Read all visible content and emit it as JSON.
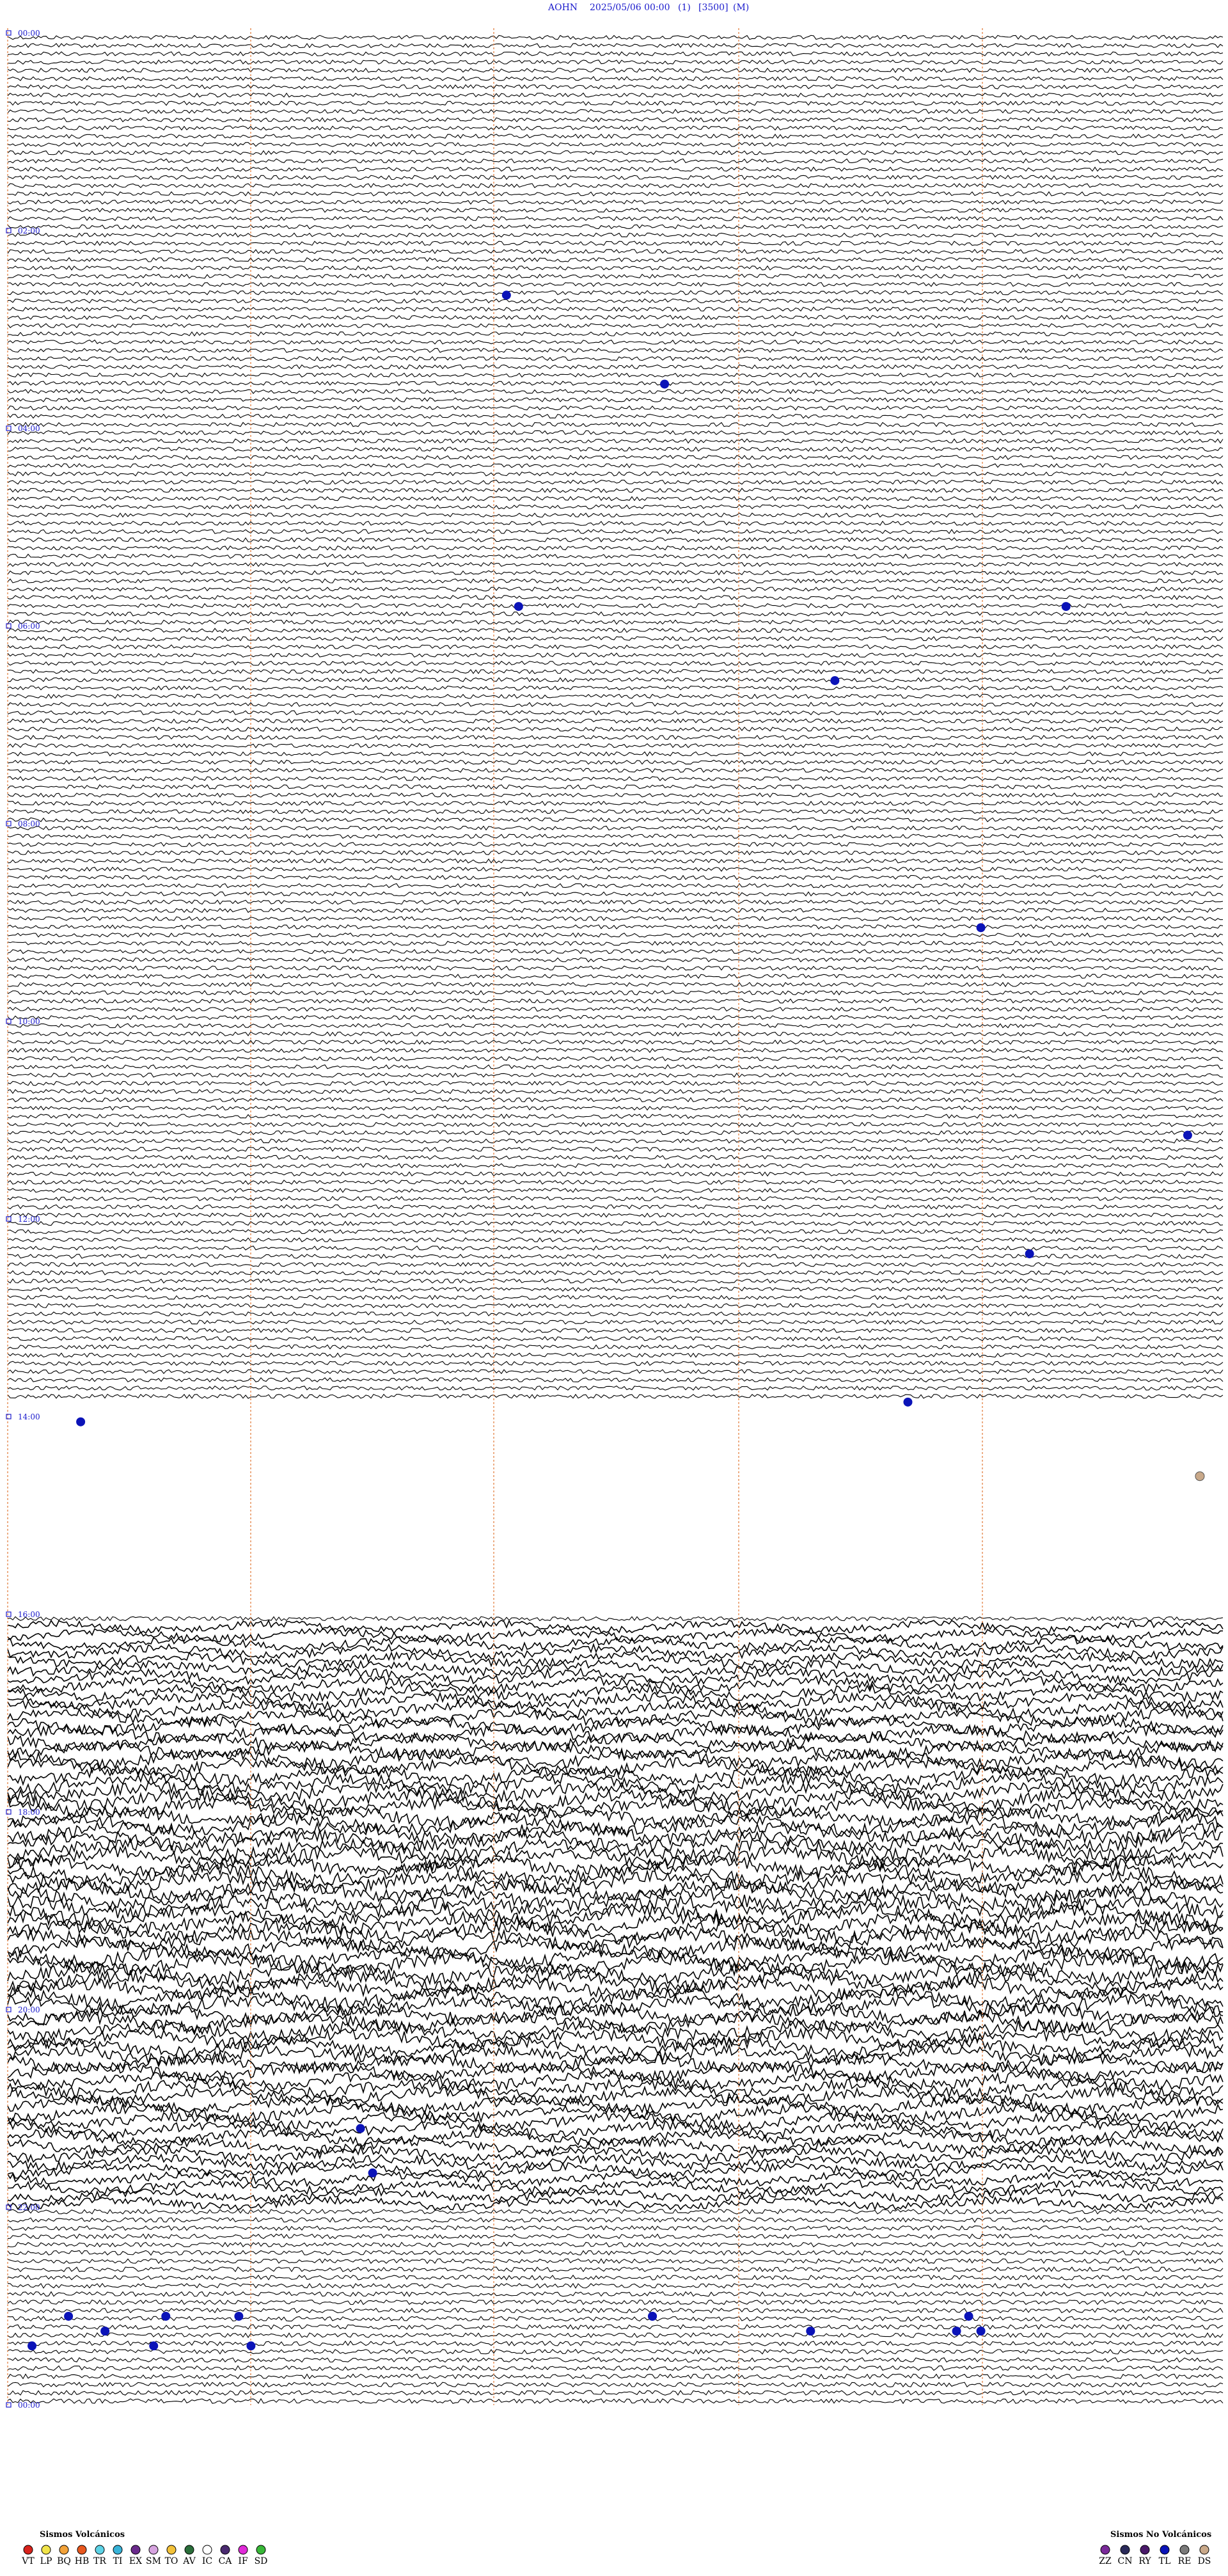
{
  "header": {
    "station": "AOHN",
    "datetime": "2025/05/06 00:00",
    "field1": "(1)",
    "field2": "[3500]",
    "field3": "(M)"
  },
  "colors": {
    "trace": "#000000",
    "gridline": "#e58a50",
    "event": "#0b13b8",
    "text": "#1a1acc"
  },
  "chart_data": {
    "type": "seismogram-helicorder",
    "title": "",
    "xlabel": "",
    "ylabel": "",
    "hour_labels": [
      {
        "hour": 0,
        "text": "00:00"
      },
      {
        "hour": 2,
        "text": "02:00"
      },
      {
        "hour": 4,
        "text": "04:00"
      },
      {
        "hour": 6,
        "text": "06:00"
      },
      {
        "hour": 8,
        "text": "08:00"
      },
      {
        "hour": 10,
        "text": "10:00"
      },
      {
        "hour": 12,
        "text": "12:00"
      },
      {
        "hour": 14,
        "text": "14:00"
      },
      {
        "hour": 16,
        "text": "16:00"
      },
      {
        "hour": 18,
        "text": "18:00"
      },
      {
        "hour": 20,
        "text": "20:00"
      },
      {
        "hour": 22,
        "text": "22:00"
      },
      {
        "hour": 24,
        "text": "00:00"
      }
    ],
    "total_hours": 24,
    "gap_hours": [
      13.8,
      16.0
    ],
    "events": [
      {
        "hour": 2.65,
        "minute": 41
      },
      {
        "hour": 3.55,
        "minute": 54
      },
      {
        "hour": 5.8,
        "minute": 42
      },
      {
        "hour": 5.8,
        "minute": 87
      },
      {
        "hour": 6.55,
        "minute": 68
      },
      {
        "hour": 9.05,
        "minute": 80
      },
      {
        "hour": 11.15,
        "minute": 97
      },
      {
        "hour": 12.35,
        "minute": 84
      },
      {
        "hour": 13.85,
        "minute": 74
      },
      {
        "hour": 14.05,
        "minute": 6
      },
      {
        "hour": 21.2,
        "minute": 29
      },
      {
        "hour": 21.65,
        "minute": 30
      },
      {
        "hour": 23.1,
        "minute": 5
      },
      {
        "hour": 23.1,
        "minute": 13
      },
      {
        "hour": 23.1,
        "minute": 19
      },
      {
        "hour": 23.1,
        "minute": 53
      },
      {
        "hour": 23.1,
        "minute": 79
      },
      {
        "hour": 23.1,
        "minute": 53
      },
      {
        "hour": 23.25,
        "minute": 8
      },
      {
        "hour": 23.25,
        "minute": 66
      },
      {
        "hour": 23.25,
        "minute": 78
      },
      {
        "hour": 23.25,
        "minute": 80
      },
      {
        "hour": 23.4,
        "minute": 2
      },
      {
        "hour": 23.4,
        "minute": 12
      },
      {
        "hour": 23.4,
        "minute": 20
      }
    ],
    "special_events": [
      {
        "hour": 14.6,
        "minute": 98,
        "color": "#c9a98a"
      }
    ]
  },
  "legend_volcanic": {
    "title": "Sismos Volcánicos",
    "items": [
      {
        "code": "VT",
        "color": "#d8231c"
      },
      {
        "code": "LP",
        "color": "#f1e44a"
      },
      {
        "code": "BQ",
        "color": "#f2a23a"
      },
      {
        "code": "HB",
        "color": "#e8571e"
      },
      {
        "code": "TR",
        "color": "#5dd3e6"
      },
      {
        "code": "TI",
        "color": "#38b3d8"
      },
      {
        "code": "EX",
        "color": "#6a2a8c"
      },
      {
        "code": "SM",
        "color": "#d7a4e0"
      },
      {
        "code": "TO",
        "color": "#f3c23a"
      },
      {
        "code": "AV",
        "color": "#2a6e3a"
      },
      {
        "code": "IC",
        "color": "#ffffff"
      },
      {
        "code": "CA",
        "color": "#4a2a70"
      },
      {
        "code": "IF",
        "color": "#e02ad8"
      },
      {
        "code": "SD",
        "color": "#38b838"
      }
    ]
  },
  "legend_nonvolcanic": {
    "title": "Sismos No Volcánicos",
    "items": [
      {
        "code": "ZZ",
        "color": "#7a2a9a"
      },
      {
        "code": "CN",
        "color": "#2a2a5a"
      },
      {
        "code": "RY",
        "color": "#4a1a6a"
      },
      {
        "code": "TL",
        "color": "#0b13b8"
      },
      {
        "code": "RE",
        "color": "#7a7a7a"
      },
      {
        "code": "DS",
        "color": "#c9a98a"
      }
    ]
  }
}
